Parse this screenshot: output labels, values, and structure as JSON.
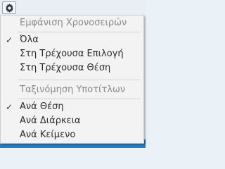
{
  "toolbar": {
    "settings_icon": "gear-icon"
  },
  "menu": {
    "section1": {
      "header": "Εμφάνιση Χρονοσειρών",
      "items": [
        {
          "label": "Όλα",
          "checked": true
        },
        {
          "label": "Στη Τρέχουσα Επιλογή",
          "checked": false
        },
        {
          "label": "Στη Τρέχουσα Θέση",
          "checked": false
        }
      ]
    },
    "section2": {
      "header": "Ταξινόμηση Υποτίτλων",
      "items": [
        {
          "label": "Ανά Θέση",
          "checked": true
        },
        {
          "label": "Ανά Διάρκεια",
          "checked": false
        },
        {
          "label": "Ανά Κείμενο",
          "checked": false
        }
      ]
    },
    "check_glyph": "✓"
  }
}
